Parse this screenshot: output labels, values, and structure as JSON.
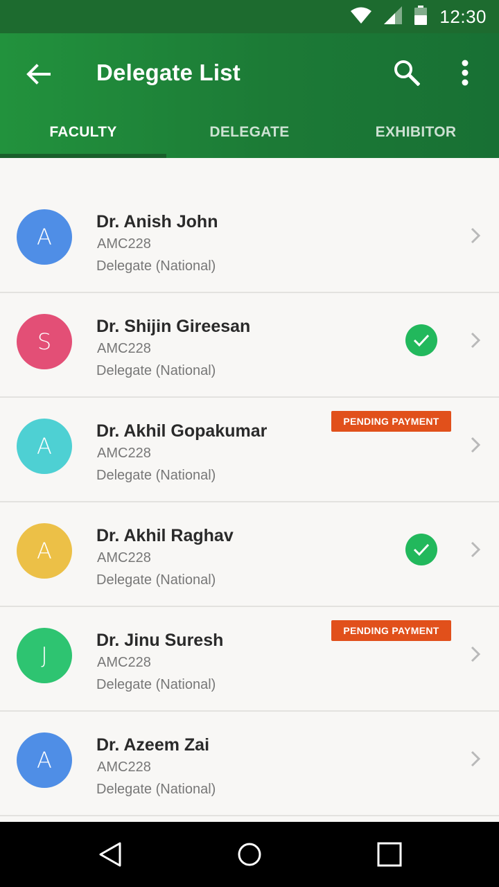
{
  "status_bar": {
    "time": "12:30",
    "icons": [
      "wifi-icon",
      "cell-signal-icon",
      "battery-icon"
    ]
  },
  "app_bar": {
    "title": "Delegate List",
    "back_icon": "arrow-back-icon",
    "search_icon": "search-icon",
    "more_icon": "more-vert-icon"
  },
  "tabs": [
    {
      "label": "FACULTY",
      "active": true
    },
    {
      "label": "DELEGATE",
      "active": false
    },
    {
      "label": "EXHIBITOR",
      "active": false
    }
  ],
  "colors": {
    "primary": "#1c7a36",
    "status_bar": "#1d6b2f",
    "check": "#22b85c",
    "pending": "#e1501b"
  },
  "delegates": [
    {
      "initial": "A",
      "avatar_color": "#4f8ee6",
      "name": "Dr. Anish John",
      "code": "AMC228",
      "role": "Delegate (National)",
      "verified": false,
      "badge": ""
    },
    {
      "initial": "S",
      "avatar_color": "#e34f76",
      "name": "Dr. Shijin Gireesan",
      "code": "AMC228",
      "role": "Delegate (National)",
      "verified": true,
      "badge": ""
    },
    {
      "initial": "A",
      "avatar_color": "#4ed0d3",
      "name": "Dr. Akhil Gopakumar",
      "code": "AMC228",
      "role": "Delegate (National)",
      "verified": false,
      "badge": "PENDING PAYMENT"
    },
    {
      "initial": "A",
      "avatar_color": "#ecc047",
      "name": "Dr. Akhil Raghav",
      "code": "AMC228",
      "role": "Delegate (National)",
      "verified": true,
      "badge": ""
    },
    {
      "initial": "J",
      "avatar_color": "#2ec471",
      "name": "Dr. Jinu Suresh",
      "code": "AMC228",
      "role": "Delegate (National)",
      "verified": false,
      "badge": "PENDING PAYMENT"
    },
    {
      "initial": "A",
      "avatar_color": "#4f8ee6",
      "name": "Dr. Azeem Zai",
      "code": "AMC228",
      "role": "Delegate (National)",
      "verified": false,
      "badge": ""
    }
  ],
  "nav_bar": {
    "icons": [
      "nav-back-icon",
      "nav-home-icon",
      "nav-recents-icon"
    ]
  }
}
